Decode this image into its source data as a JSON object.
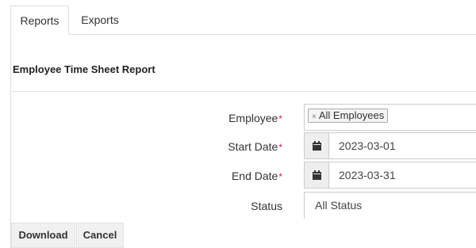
{
  "tabs": [
    {
      "label": "Reports",
      "active": true
    },
    {
      "label": "Exports",
      "active": false
    }
  ],
  "panel": {
    "title": "Employee Time Sheet Report"
  },
  "form": {
    "required_marker": "*",
    "employee": {
      "label": "Employee",
      "tag": "All Employees",
      "tag_remove": "×"
    },
    "start_date": {
      "label": "Start Date",
      "value": "2023-03-01",
      "icon": "calendar-icon"
    },
    "end_date": {
      "label": "End Date",
      "value": "2023-03-31",
      "icon": "calendar-icon"
    },
    "status": {
      "label": "Status",
      "value": "All Status"
    }
  },
  "buttons": {
    "download": "Download",
    "cancel": "Cancel"
  },
  "colors": {
    "required": "#c7254e",
    "border": "#cccccc",
    "addon_bg": "#eeeeee",
    "button_bg": "#f0f0f0"
  }
}
